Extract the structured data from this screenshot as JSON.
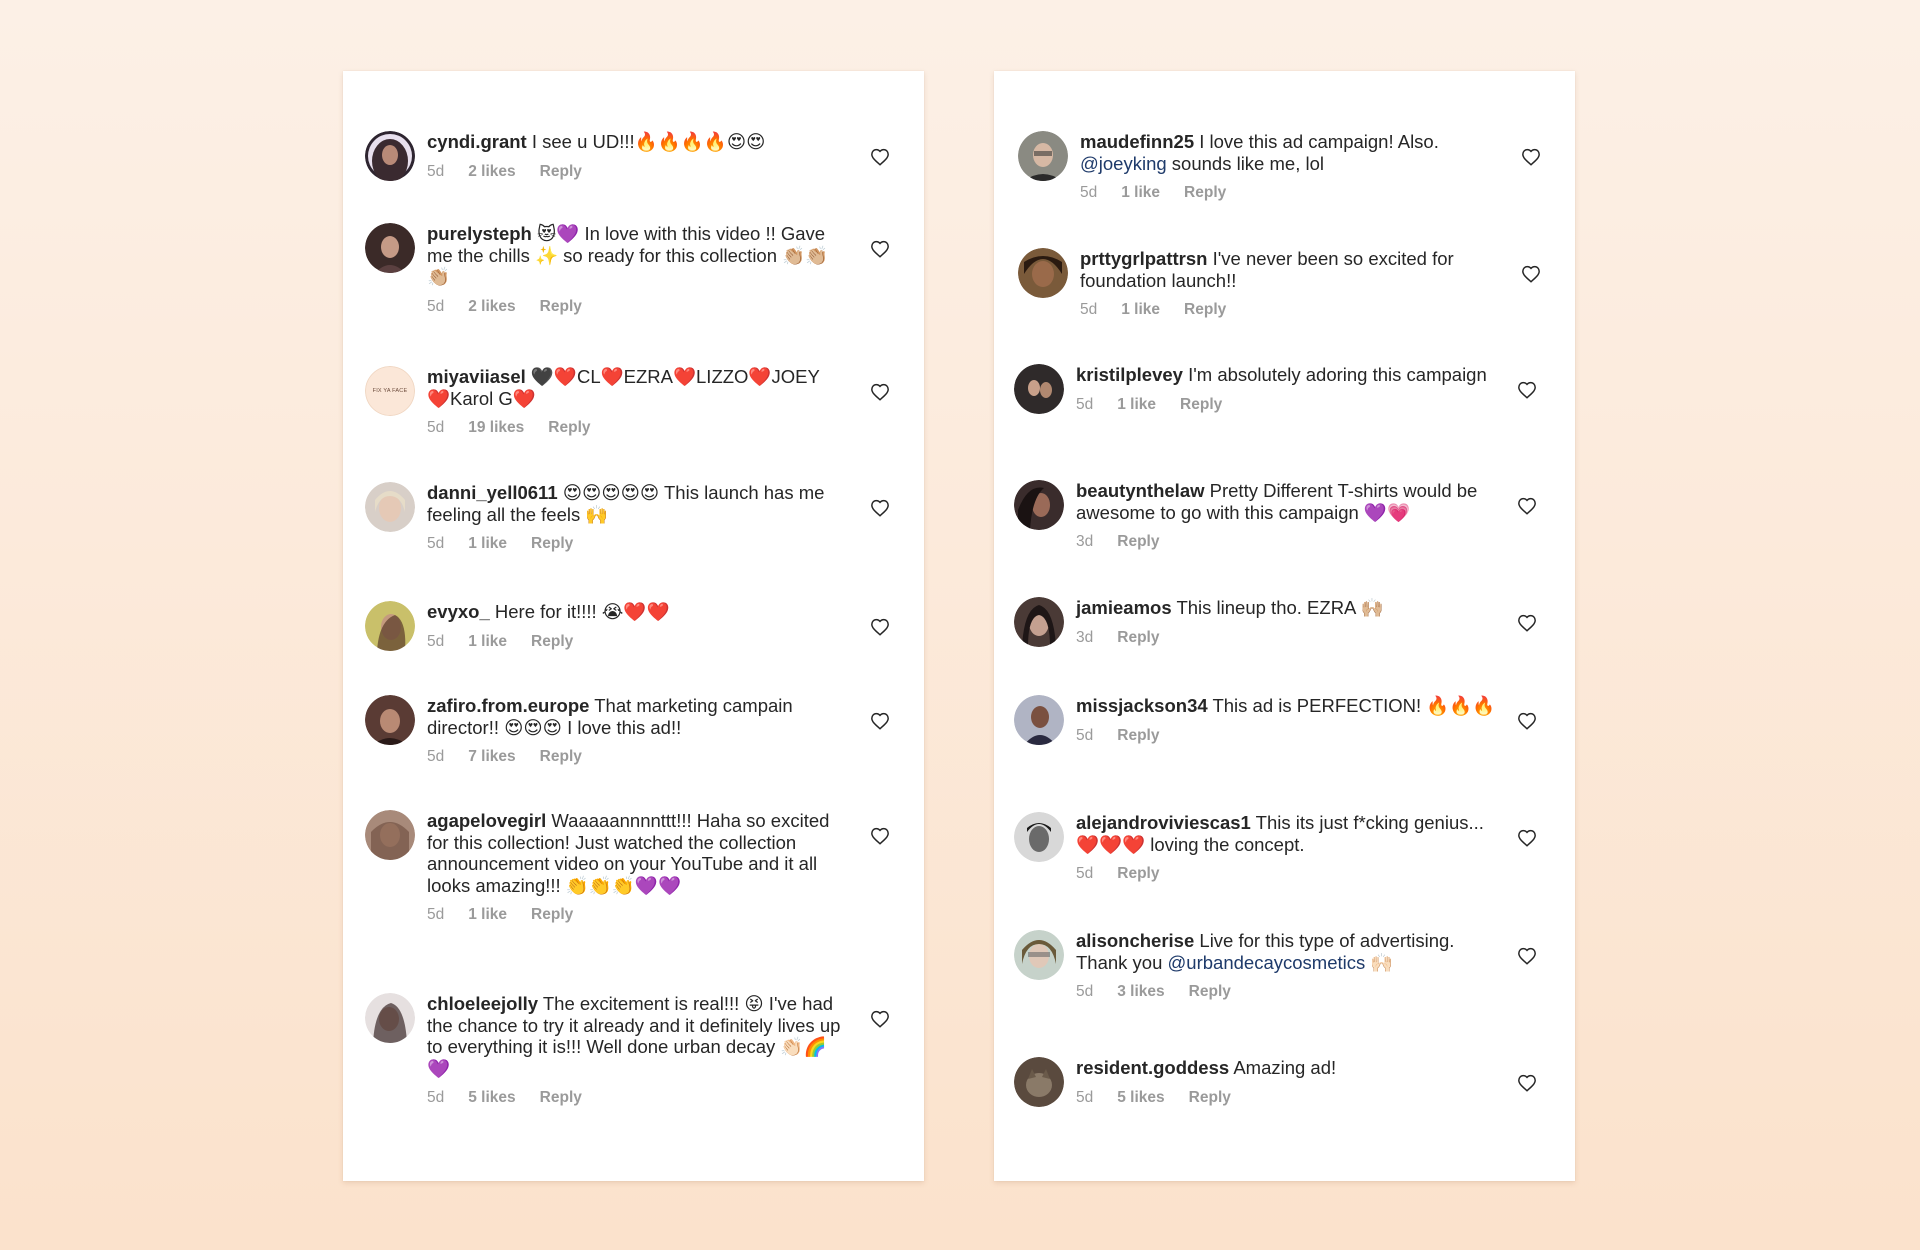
{
  "left_panel": {
    "comments": [
      {
        "username": "cyndi.grant",
        "text": "I see u UD!!!🔥🔥🔥🔥😍😍",
        "time": "5d",
        "likes": "2 likes",
        "reply": "Reply",
        "avatar_color": "#4a3a3f"
      },
      {
        "username": "purelysteph",
        "text": "😻💜 In love with this video !! Gave me the chills ✨ so ready for this collection 👏🏼👏🏼👏🏼",
        "time": "5d",
        "likes": "2 likes",
        "reply": "Reply",
        "avatar_color": "#3b2a28"
      },
      {
        "username": "miyaviiasel",
        "text": "🖤❤️CL❤️EZRA❤️LIZZO❤️JOEY ❤️Karol G❤️",
        "time": "5d",
        "likes": "19 likes",
        "reply": "Reply",
        "avatar_label": "FIX YA FACE"
      },
      {
        "username": "danni_yell0611",
        "text": "😍😍😍😍😍 This launch has me feeling all the feels 🙌",
        "time": "5d",
        "likes": "1 like",
        "reply": "Reply",
        "avatar_color": "#c9b7a8"
      },
      {
        "username": "evyxo_",
        "text": "Here for it!!!! 😭❤️❤️",
        "time": "5d",
        "likes": "1 like",
        "reply": "Reply",
        "avatar_color": "#8a7a3a"
      },
      {
        "username": "zafiro.from.europe",
        "text": "That marketing campain director!! 😍😍😍 I love this ad!!",
        "time": "5d",
        "likes": "7 likes",
        "reply": "Reply",
        "avatar_color": "#5a3b34"
      },
      {
        "username": "agapelovegirl",
        "text": "Waaaaannnnttt!!! Haha so excited for this collection! Just watched the collection announcement video on your YouTube and it all looks amazing!!! 👏👏👏💜💜",
        "time": "5d",
        "likes": "1 like",
        "reply": "Reply",
        "avatar_color": "#8a6a5a"
      },
      {
        "username": "chloeleejolly",
        "text": "The excitement is real!!! 😝 I've had the chance to try it already and it definitely lives up to everything it is!!! Well done urban decay 👏🏻🌈💜",
        "time": "5d",
        "likes": "5 likes",
        "reply": "Reply",
        "avatar_color": "#6a5a5a"
      }
    ]
  },
  "right_panel": {
    "comments": [
      {
        "username": "maudefinn25",
        "text_before": "I love this ad campaign!  Also. ",
        "mention": "@joeyking",
        "text_after": " sounds like me, lol",
        "time": "5d",
        "likes": "1 like",
        "reply": "Reply",
        "avatar_color": "#6d6a63"
      },
      {
        "username": "prttygrlpattrsn",
        "text": "I've never been so excited for foundation launch!!",
        "time": "5d",
        "likes": "1 like",
        "reply": "Reply",
        "avatar_color": "#5a3a2a"
      },
      {
        "username": "kristilplevey",
        "text": "I'm absolutely adoring this campaign",
        "time": "5d",
        "likes": "1 like",
        "reply": "Reply",
        "avatar_color": "#2f2a2a"
      },
      {
        "username": "beautynthelaw",
        "text": "Pretty Different T-shirts would be awesome to go with this campaign 💜💗",
        "time": "3d",
        "likes": "",
        "reply": "Reply",
        "avatar_color": "#3a2c2c"
      },
      {
        "username": "jamieamos",
        "text": "This lineup tho. EZRA 🙌🏼",
        "time": "3d",
        "likes": "",
        "reply": "Reply",
        "avatar_color": "#4a3a36"
      },
      {
        "username": "missjackson34",
        "text": "This ad is PERFECTION! 🔥🔥🔥",
        "time": "5d",
        "likes": "",
        "reply": "Reply",
        "avatar_color": "#4a4a5a"
      },
      {
        "username": "alejandroviviescas1",
        "text": "This its just f*cking genius...❤️❤️❤️ loving the concept.",
        "time": "5d",
        "likes": "",
        "reply": "Reply",
        "avatar_color": "#3a3a3a"
      },
      {
        "username": "alisoncherise",
        "text_before": "Live for this type of advertising. Thank you ",
        "mention": "@urbandecaycosmetics",
        "text_after": " 🙌🏻",
        "time": "5d",
        "likes": "3 likes",
        "reply": "Reply",
        "avatar_color": "#9aa8a0"
      },
      {
        "username": "resident.goddess",
        "text": "Amazing ad!",
        "time": "5d",
        "likes": "5 likes",
        "reply": "Reply",
        "avatar_color": "#5a4a3e"
      }
    ]
  }
}
